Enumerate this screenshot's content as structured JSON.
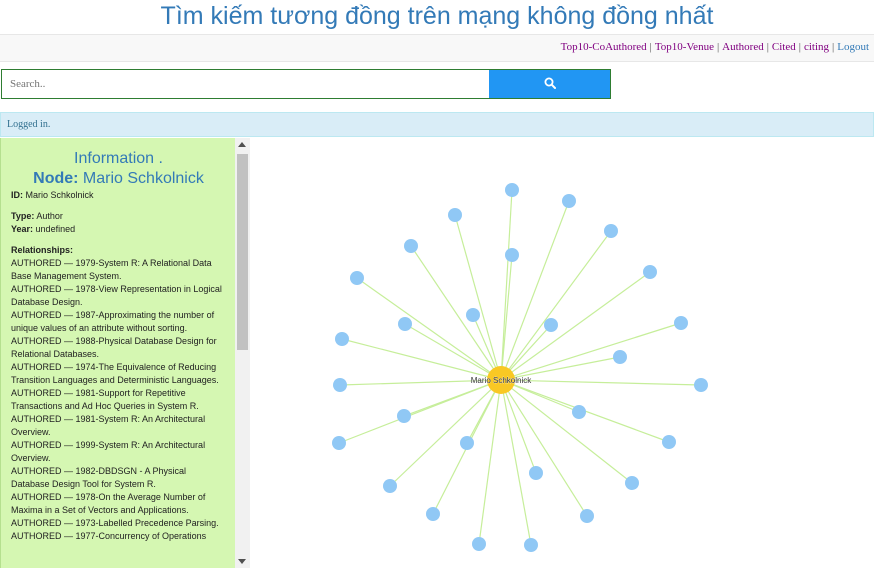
{
  "page_title": "Tìm kiếm tương đồng trên mạng không đồng nhất",
  "nav": {
    "links": [
      "Top10-CoAuthored",
      "Top10-Venue",
      "Authored",
      "Cited",
      "citing"
    ],
    "logout": "Logout",
    "separator": "|"
  },
  "search": {
    "placeholder": "Search..",
    "button_icon": "search-icon"
  },
  "alert": {
    "text": "Logged in."
  },
  "info": {
    "header": "Information .",
    "node_label": "Node:",
    "node_name": "Mario Schkolnick",
    "id_label": "ID:",
    "id_value": "Mario Schkolnick",
    "type_label": "Type:",
    "type_value": "Author",
    "year_label": "Year:",
    "year_value": "undefined",
    "relationships_label": "Relationships:",
    "relationships": [
      "AUTHORED — 1979-System R: A Relational Data Base Management System.",
      "AUTHORED — 1978-View Representation in Logical Database Design.",
      "AUTHORED — 1987-Approximating the number of unique values of an attribute without sorting.",
      "AUTHORED — 1988-Physical Database Design for Relational Databases.",
      "AUTHORED — 1974-The Equivalence of Reducing Transition Languages and Deterministic Languages.",
      "AUTHORED — 1981-Support for Repetitive Transactions and Ad Hoc Queries in System R.",
      "AUTHORED — 1981-System R: An Architectural Overview.",
      "AUTHORED — 1999-System R: An Architectural Overview.",
      "AUTHORED — 1982-DBDSGN - A Physical Database Design Tool for System R.",
      "AUTHORED — 1978-On the Average Number of Maxima in a Set of Vectors and Applications.",
      "AUTHORED — 1973-Labelled Precedence Parsing.",
      "AUTHORED — 1977-Concurrency of Operations"
    ]
  },
  "graph": {
    "center_label": "Mario Schkolnick",
    "center_color": "#f9c824",
    "node_color": "#90c8f5",
    "edge_color": "#c6ee9a",
    "neighbor_count": 28
  },
  "colors": {
    "title": "#337ab7",
    "search_button": "#2196f3",
    "panel_bg": "#d5f7b2",
    "alert_bg": "#d9edf7"
  }
}
